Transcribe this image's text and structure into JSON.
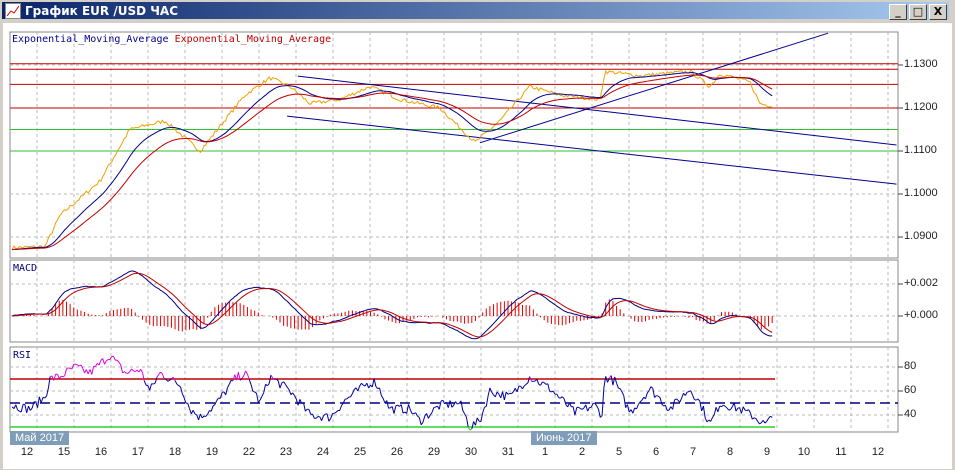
{
  "window": {
    "title": "График EUR /USD  ЧАС",
    "minimize": "_",
    "maximize": "□",
    "close": "X"
  },
  "legend": {
    "ema_fast": "Exponential_Moving_Average",
    "ema_slow": "Exponential_Moving_Average"
  },
  "panels": {
    "macd": "MACD",
    "rsi": "RSI"
  },
  "colors": {
    "price": "#f0a000",
    "ema_fast": "#000090",
    "ema_slow": "#c00000",
    "overbought": "#c00000",
    "oversold": "#00c000",
    "rsi_hot": "#e000e0"
  },
  "chart_data": {
    "type": "line",
    "price_axis": {
      "ticks": [
        "1.1300",
        "1.1200",
        "1.1100",
        "1.1000",
        "1.0900"
      ],
      "values": [
        1.13,
        1.12,
        1.11,
        1.1,
        1.09
      ]
    },
    "macd_axis": {
      "ticks": [
        "+0.002",
        "+0.000"
      ],
      "values": [
        0.002,
        0
      ]
    },
    "rsi_axis": {
      "ticks": [
        "80",
        "60",
        "40"
      ],
      "values": [
        80,
        60,
        40
      ],
      "levels": [
        70,
        50,
        30
      ]
    },
    "x_ticks": [
      "12",
      "15",
      "16",
      "17",
      "18",
      "19",
      "22",
      "23",
      "24",
      "25",
      "26",
      "29",
      "30",
      "31",
      "1",
      "2",
      "5",
      "6",
      "7",
      "8",
      "9",
      "10",
      "11",
      "12"
    ],
    "months": [
      {
        "label": "Май 2017",
        "index": 0
      },
      {
        "label": "Июнь 2017",
        "index": 14
      }
    ],
    "price": [
      [
        -0.4,
        1.0875
      ],
      [
        0.49,
        1.0878
      ],
      [
        0.89,
        1.095
      ],
      [
        1.97,
        1.103
      ],
      [
        2.78,
        1.115
      ],
      [
        3.73,
        1.117
      ],
      [
        4.68,
        1.11
      ],
      [
        5.89,
        1.123
      ],
      [
        6.57,
        1.127
      ],
      [
        7.11,
        1.125
      ],
      [
        7.65,
        1.121
      ],
      [
        8.46,
        1.122
      ],
      [
        9.27,
        1.125
      ],
      [
        10.08,
        1.122
      ],
      [
        11.16,
        1.12
      ],
      [
        12.11,
        1.112
      ],
      [
        12.78,
        1.117
      ],
      [
        13.59,
        1.125
      ],
      [
        14.41,
        1.123
      ],
      [
        15.49,
        1.122
      ],
      [
        15.62,
        1.1285
      ],
      [
        16.57,
        1.1275
      ],
      [
        17.92,
        1.1285
      ],
      [
        18.46,
        1.125
      ],
      [
        18.73,
        1.128
      ],
      [
        19.54,
        1.126
      ],
      [
        19.81,
        1.121
      ],
      [
        20.14,
        1.1205
      ]
    ],
    "horizontal_levels": [
      {
        "price": 1.1303,
        "color": "red"
      },
      {
        "price": 1.129,
        "color": "red"
      },
      {
        "price": 1.1255,
        "color": "red"
      },
      {
        "price": 1.12,
        "color": "red"
      },
      {
        "price": 1.115,
        "color": "green"
      },
      {
        "price": 1.11,
        "color": "green"
      }
    ],
    "trendlines": [
      [
        7.32,
        1.1274,
        23.5,
        1.1114
      ],
      [
        7.03,
        1.1181,
        23.5,
        1.1023
      ],
      [
        12.24,
        1.1119,
        21.65,
        1.1374
      ]
    ],
    "rsi": [
      [
        -0.4,
        48
      ],
      [
        0.08,
        45
      ],
      [
        0.49,
        55
      ],
      [
        0.62,
        70
      ],
      [
        0.89,
        72
      ],
      [
        1.3,
        80
      ],
      [
        1.7,
        75
      ],
      [
        2.24,
        90
      ],
      [
        2.65,
        75
      ],
      [
        3.05,
        78
      ],
      [
        3.32,
        60
      ],
      [
        3.59,
        75
      ],
      [
        4.14,
        65
      ],
      [
        4.41,
        45
      ],
      [
        4.68,
        38
      ],
      [
        5.08,
        48
      ],
      [
        5.62,
        70
      ],
      [
        5.89,
        75
      ],
      [
        6.3,
        50
      ],
      [
        6.57,
        72
      ],
      [
        7.11,
        60
      ],
      [
        7.65,
        40
      ],
      [
        8.19,
        38
      ],
      [
        8.59,
        52
      ],
      [
        9.14,
        65
      ],
      [
        9.41,
        68
      ],
      [
        9.81,
        45
      ],
      [
        10.35,
        45
      ],
      [
        10.62,
        35
      ],
      [
        11.16,
        48
      ],
      [
        11.7,
        50
      ],
      [
        11.97,
        30
      ],
      [
        12.24,
        35
      ],
      [
        12.51,
        60
      ],
      [
        13.05,
        55
      ],
      [
        13.59,
        72
      ],
      [
        14.14,
        62
      ],
      [
        14.81,
        42
      ],
      [
        15.35,
        48
      ],
      [
        15.54,
        40
      ],
      [
        15.62,
        72
      ],
      [
        15.89,
        68
      ],
      [
        16.3,
        42
      ],
      [
        16.84,
        62
      ],
      [
        17.38,
        45
      ],
      [
        17.92,
        62
      ],
      [
        18.19,
        50
      ],
      [
        18.46,
        32
      ],
      [
        18.73,
        50
      ],
      [
        19.27,
        45
      ],
      [
        19.68,
        38
      ],
      [
        19.95,
        32
      ],
      [
        20.22,
        40
      ]
    ]
  }
}
